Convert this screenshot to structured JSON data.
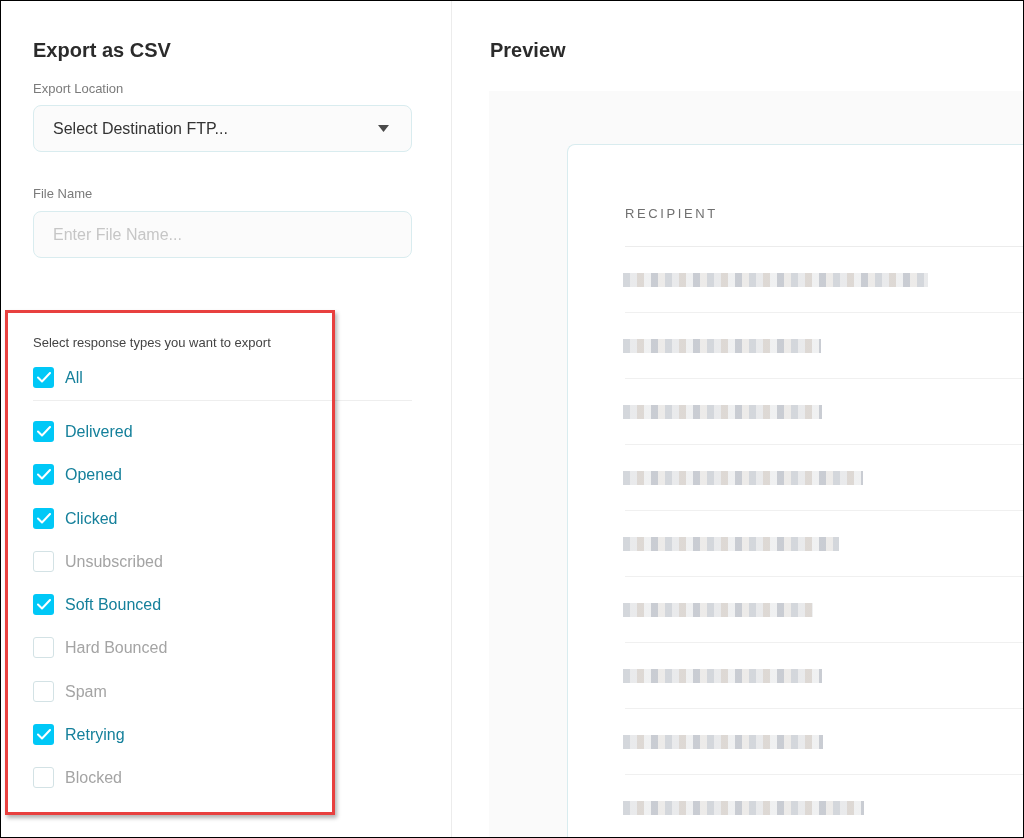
{
  "left_panel": {
    "title": "Export as CSV",
    "export_location": {
      "label": "Export Location",
      "value": "Select Destination FTP..."
    },
    "file_name": {
      "label": "File Name",
      "placeholder": "Enter File Name..."
    },
    "response_types": {
      "prompt": "Select response types you want to export",
      "all": {
        "label": "All",
        "checked": true
      },
      "items": [
        {
          "label": "Delivered",
          "checked": true
        },
        {
          "label": "Opened",
          "checked": true
        },
        {
          "label": "Clicked",
          "checked": true
        },
        {
          "label": "Unsubscribed",
          "checked": false
        },
        {
          "label": "Soft Bounced",
          "checked": true
        },
        {
          "label": "Hard Bounced",
          "checked": false
        },
        {
          "label": "Spam",
          "checked": false
        },
        {
          "label": "Retrying",
          "checked": true
        },
        {
          "label": "Blocked",
          "checked": false
        }
      ]
    }
  },
  "preview": {
    "title": "Preview",
    "table": {
      "columns": [
        "RECIPIENT"
      ]
    }
  }
}
